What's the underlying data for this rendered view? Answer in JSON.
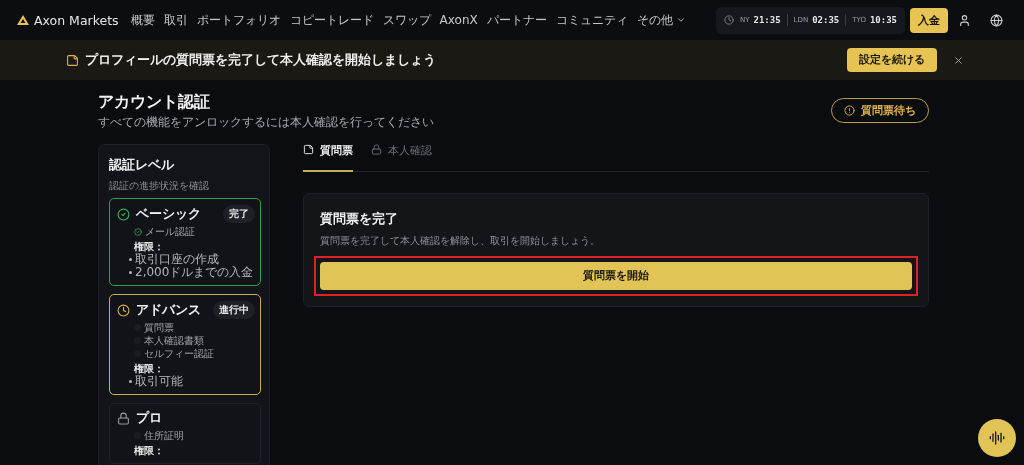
{
  "nav": {
    "brand": "Axon Markets",
    "items": [
      {
        "label": "概要"
      },
      {
        "label": "取引"
      },
      {
        "label": "ポートフォリオ"
      },
      {
        "label": "コピートレード"
      },
      {
        "label": "スワップ"
      },
      {
        "label": "AxonX"
      },
      {
        "label": "パートナー"
      },
      {
        "label": "コミュニティ"
      }
    ],
    "more": "その他",
    "clocks": [
      {
        "city": "NY",
        "time": "21:35"
      },
      {
        "city": "LDN",
        "time": "02:35"
      },
      {
        "city": "TYO",
        "time": "10:35"
      }
    ],
    "deposit": "入金"
  },
  "banner": {
    "text": "プロフィールの質問票を完了して本人確認を開始しましょう",
    "button": "設定を続ける"
  },
  "page": {
    "title": "アカウント認証",
    "subtitle": "すべての機能をアンロックするには本人確認を行ってください",
    "status": "質問票待ち"
  },
  "sidebar": {
    "title": "認証レベル",
    "subtitle": "認証の進捗状況を確認",
    "levels": [
      {
        "name": "ベーシック",
        "kind": "complete",
        "badge": "完了",
        "requirements": [
          {
            "label": "メール認証",
            "checked": true
          }
        ],
        "permissions_label": "権限：",
        "permissions": [
          "取引口座の作成",
          "2,000ドルまでの入金"
        ]
      },
      {
        "name": "アドバンス",
        "kind": "in_progress",
        "badge": "進行中",
        "requirements": [
          {
            "label": "質問票",
            "checked": false
          },
          {
            "label": "本人確認書類",
            "checked": false
          },
          {
            "label": "セルフィー認証",
            "checked": false
          }
        ],
        "permissions_label": "権限：",
        "permissions": [
          "取引可能"
        ]
      },
      {
        "name": "プロ",
        "kind": "locked",
        "requirements": [
          {
            "label": "住所証明",
            "checked": false
          }
        ],
        "permissions_label": "権限："
      }
    ]
  },
  "tabs": [
    {
      "label": "質問票",
      "selected": true
    },
    {
      "label": "本人確認",
      "selected": false
    }
  ],
  "card": {
    "title": "質問票を完了",
    "description": "質問票を完了して本人確認を解除し、取引を開始しましょう。",
    "button": "質問票を開始",
    "highlighted": true
  }
}
